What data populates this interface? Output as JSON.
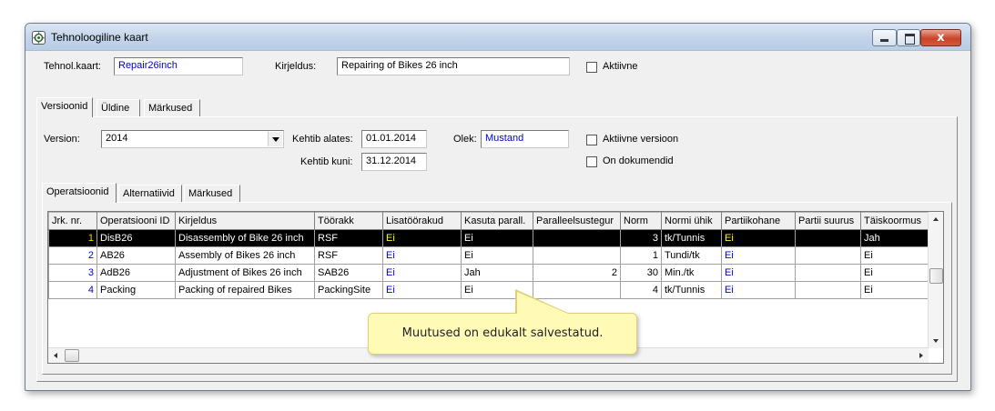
{
  "window": {
    "title": "Tehnoloogiline kaart",
    "buttons": {
      "minimize": "minimize",
      "maximize": "maximize",
      "close": "x"
    }
  },
  "header": {
    "tehnol_label": "Tehnol.kaart:",
    "tehnol_value": "Repair26inch",
    "kirjeldus_label": "Kirjeldus:",
    "kirjeldus_value": "Repairing of Bikes 26 inch",
    "aktiivne_label": "Aktiivne"
  },
  "tabs": [
    "Versioonid",
    "Üldine",
    "Märkused"
  ],
  "version": {
    "version_label": "Version:",
    "version_value": "2014",
    "kehtib_alates_label": "Kehtib alates:",
    "kehtib_alates_value": "01.01.2014",
    "kehtib_kuni_label": "Kehtib kuni:",
    "kehtib_kuni_value": "31.12.2014",
    "olek_label": "Olek:",
    "olek_value": "Mustand",
    "aktiivne_versioon_label": "Aktiivne versioon",
    "on_dokumendid_label": "On dokumendid"
  },
  "subtabs": [
    "Operatsioonid",
    "Alternatiivid",
    "Märkused"
  ],
  "grid": {
    "columns": [
      "Jrk. nr.",
      "Operatsiooni ID",
      "Kirjeldus",
      "Töörakk",
      "Lisatöörakud",
      "Kasuta parall.",
      "Paralleelsustegur",
      "Norm",
      "Normi ühik",
      "Partiikohane",
      "Partii suurus",
      "Täiskoormus"
    ],
    "rows": [
      {
        "nr": "1",
        "id": "DisB26",
        "kirjeldus": "Disassembly of Bike 26 inch",
        "toorakk": "RSF",
        "lisa": "Ei",
        "kasuta": "Ei",
        "parall": "",
        "norm": "3",
        "uhik": "tk/Tunnis",
        "partii": "Ei",
        "suurus": "",
        "taiskoormus": "Jah"
      },
      {
        "nr": "2",
        "id": "AB26",
        "kirjeldus": "Assembly of Bikes 26 inch",
        "toorakk": "RSF",
        "lisa": "Ei",
        "kasuta": "Ei",
        "parall": "",
        "norm": "1",
        "uhik": "Tundi/tk",
        "partii": "Ei",
        "suurus": "",
        "taiskoormus": "Ei"
      },
      {
        "nr": "3",
        "id": "AdB26",
        "kirjeldus": "Adjustment of Bikes 26 inch",
        "toorakk": "SAB26",
        "lisa": "Ei",
        "kasuta": "Jah",
        "parall": "2",
        "norm": "30",
        "uhik": "Min./tk",
        "partii": "Ei",
        "suurus": "",
        "taiskoormus": "Ei"
      },
      {
        "nr": "4",
        "id": "Packing",
        "kirjeldus": "Packing of repaired Bikes",
        "toorakk": "PackingSite",
        "lisa": "Ei",
        "kasuta": "Ei",
        "parall": "",
        "norm": "4",
        "uhik": "tk/Tunnis",
        "partii": "Ei",
        "suurus": "",
        "taiskoormus": "Ei"
      }
    ]
  },
  "callout": "Muutused on edukalt salvestatud.",
  "colors": {
    "accent_blue": "#0000d8",
    "selected_row": "#000000",
    "callout_bg": "#fffbb7"
  }
}
